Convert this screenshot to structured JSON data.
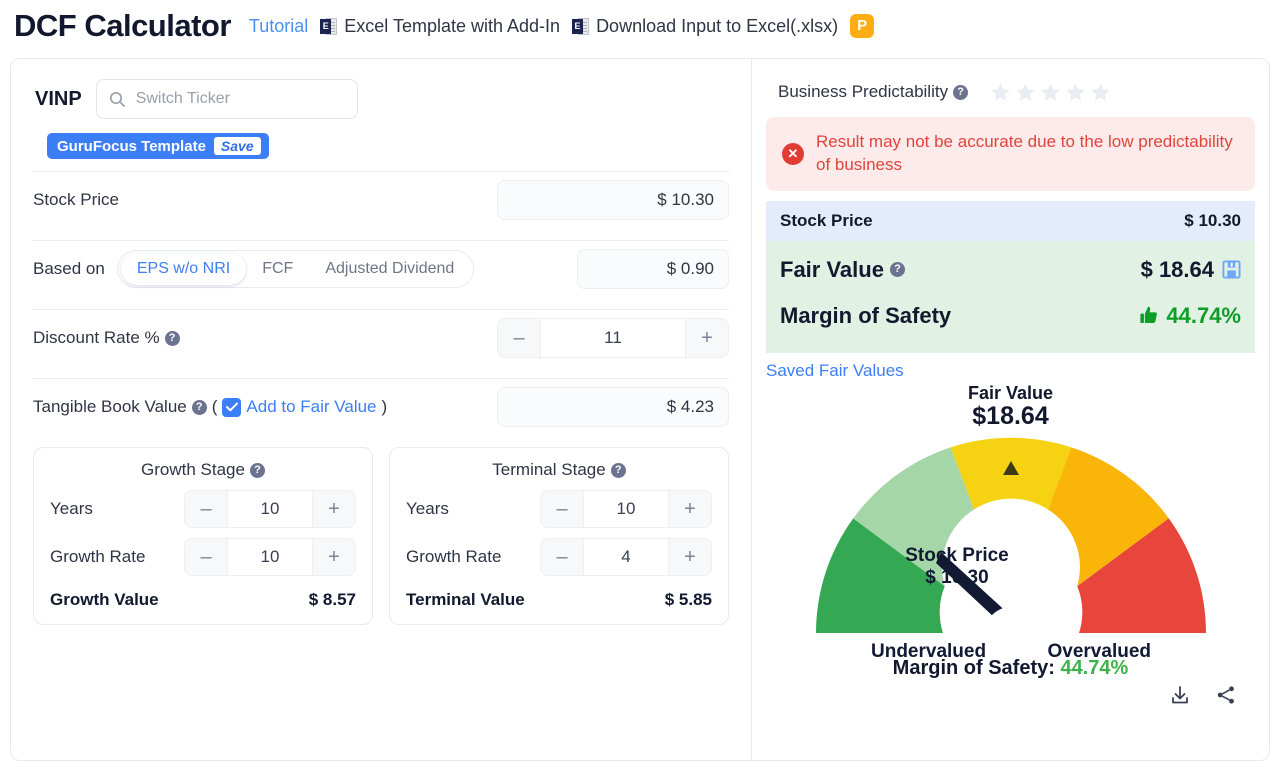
{
  "header": {
    "title": "DCF Calculator",
    "tutorial": "Tutorial",
    "excel_template": "Excel Template with Add-In",
    "download_input": "Download Input to Excel(.xlsx)",
    "premium_badge": "P",
    "excel_glyph": "E"
  },
  "left": {
    "ticker": "VINP",
    "search_placeholder": "Switch Ticker",
    "template_name": "GuruFocus Template",
    "template_save": "Save",
    "stock_price_label": "Stock Price",
    "stock_price_value": "$ 10.30",
    "based_on_label": "Based on",
    "based_on_options": [
      "EPS w/o NRI",
      "FCF",
      "Adjusted Dividend"
    ],
    "based_on_selected": "EPS w/o NRI",
    "based_on_value": "$ 0.90",
    "discount_rate_label": "Discount Rate %",
    "discount_rate_value": "11",
    "tangible_label": "Tangible Book Value",
    "tangible_paren_open": "(",
    "tangible_add_link": "Add to Fair Value",
    "tangible_paren_close": ")",
    "tangible_value": "$ 4.23",
    "minus": "–",
    "plus": "+",
    "growth_stage": {
      "title": "Growth Stage",
      "years_label": "Years",
      "years_value": "10",
      "rate_label": "Growth Rate",
      "rate_value": "10",
      "total_label": "Growth Value",
      "total_value": "$ 8.57"
    },
    "terminal_stage": {
      "title": "Terminal Stage",
      "years_label": "Years",
      "years_value": "10",
      "rate_label": "Growth Rate",
      "rate_value": "4",
      "total_label": "Terminal Value",
      "total_value": "$ 5.85"
    }
  },
  "right": {
    "predictability_label": "Business Predictability",
    "stars_total": 5,
    "stars_filled": 0,
    "warning_text": "Result may not be accurate due to the low predictability of business",
    "stock_price_label": "Stock Price",
    "stock_price_value": "$ 10.30",
    "fair_value_label": "Fair Value",
    "fair_value_value": "$ 18.64",
    "margin_label": "Margin of Safety",
    "margin_value": "44.74%",
    "saved_fair_values": "Saved Fair Values",
    "gauge": {
      "head_label": "Fair Value",
      "head_value": "$18.64",
      "stock_price_label": "Stock Price",
      "stock_price_value": "$ 10.30",
      "left_label": "Undervalued",
      "right_label": "Overvalued",
      "bottom_label": "Margin of Safety:",
      "bottom_value": "44.74%"
    }
  },
  "colors": {
    "accent_blue": "#3b7ef5",
    "green": "#0f9d28",
    "warn_red": "#e0443c",
    "premium_orange": "#ffad17",
    "gauge_dark_green": "#34a853",
    "gauge_light_green": "#a5d6a7",
    "gauge_yellow": "#f5d312",
    "gauge_orange": "#f9b508",
    "gauge_red": "#e8453c"
  }
}
